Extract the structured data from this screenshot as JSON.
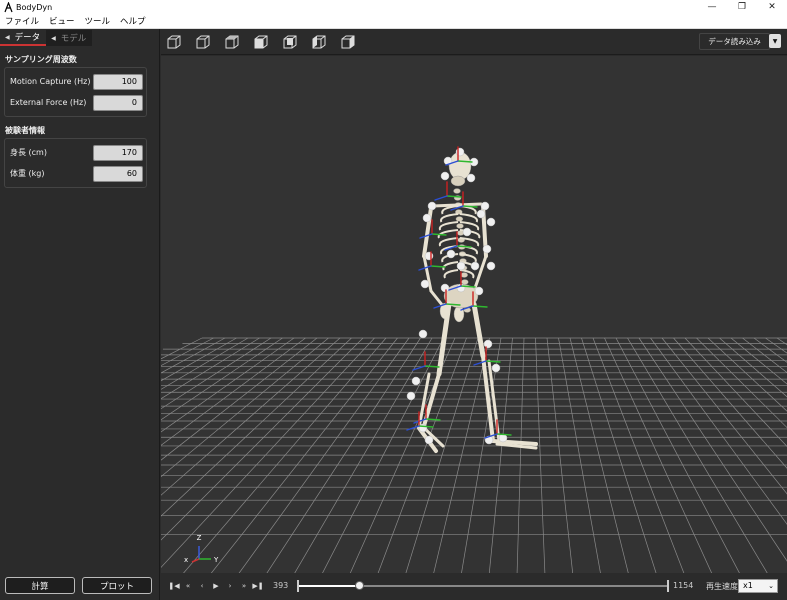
{
  "window": {
    "title": "BodyDyn"
  },
  "menu": [
    "ファイル",
    "ビュー",
    "ツール",
    "ヘルプ"
  ],
  "tabs": [
    {
      "label": "データ",
      "active": true
    },
    {
      "label": "モデル",
      "active": false
    }
  ],
  "sampling": {
    "title": "サンプリング周波数",
    "fields": [
      {
        "label": "Motion Capture (Hz)",
        "value": "100"
      },
      {
        "label": "External Force (Hz)",
        "value": "0"
      }
    ]
  },
  "subject": {
    "title": "被験者情報",
    "fields": [
      {
        "label": "身長 (cm)",
        "value": "170"
      },
      {
        "label": "体重 (kg)",
        "value": "60"
      }
    ]
  },
  "buttons": {
    "calculate": "計算",
    "plot": "プロット"
  },
  "toolbar": {
    "view_icons": [
      "view-iso-icon",
      "view-front-icon",
      "view-side-icon",
      "view-top-icon",
      "view-back-icon",
      "view-left-icon",
      "view-right-icon"
    ],
    "load_data": "データ読み込み"
  },
  "axes": {
    "x": "x",
    "y": "Y",
    "z": "Z"
  },
  "playback": {
    "start": "393",
    "end": "1154",
    "position": 0.17,
    "speed_label": "再生速度",
    "speed": "x1"
  },
  "colors": {
    "accent": "#cc3333",
    "background": "#2b2b2b",
    "viewport": "#333333"
  }
}
